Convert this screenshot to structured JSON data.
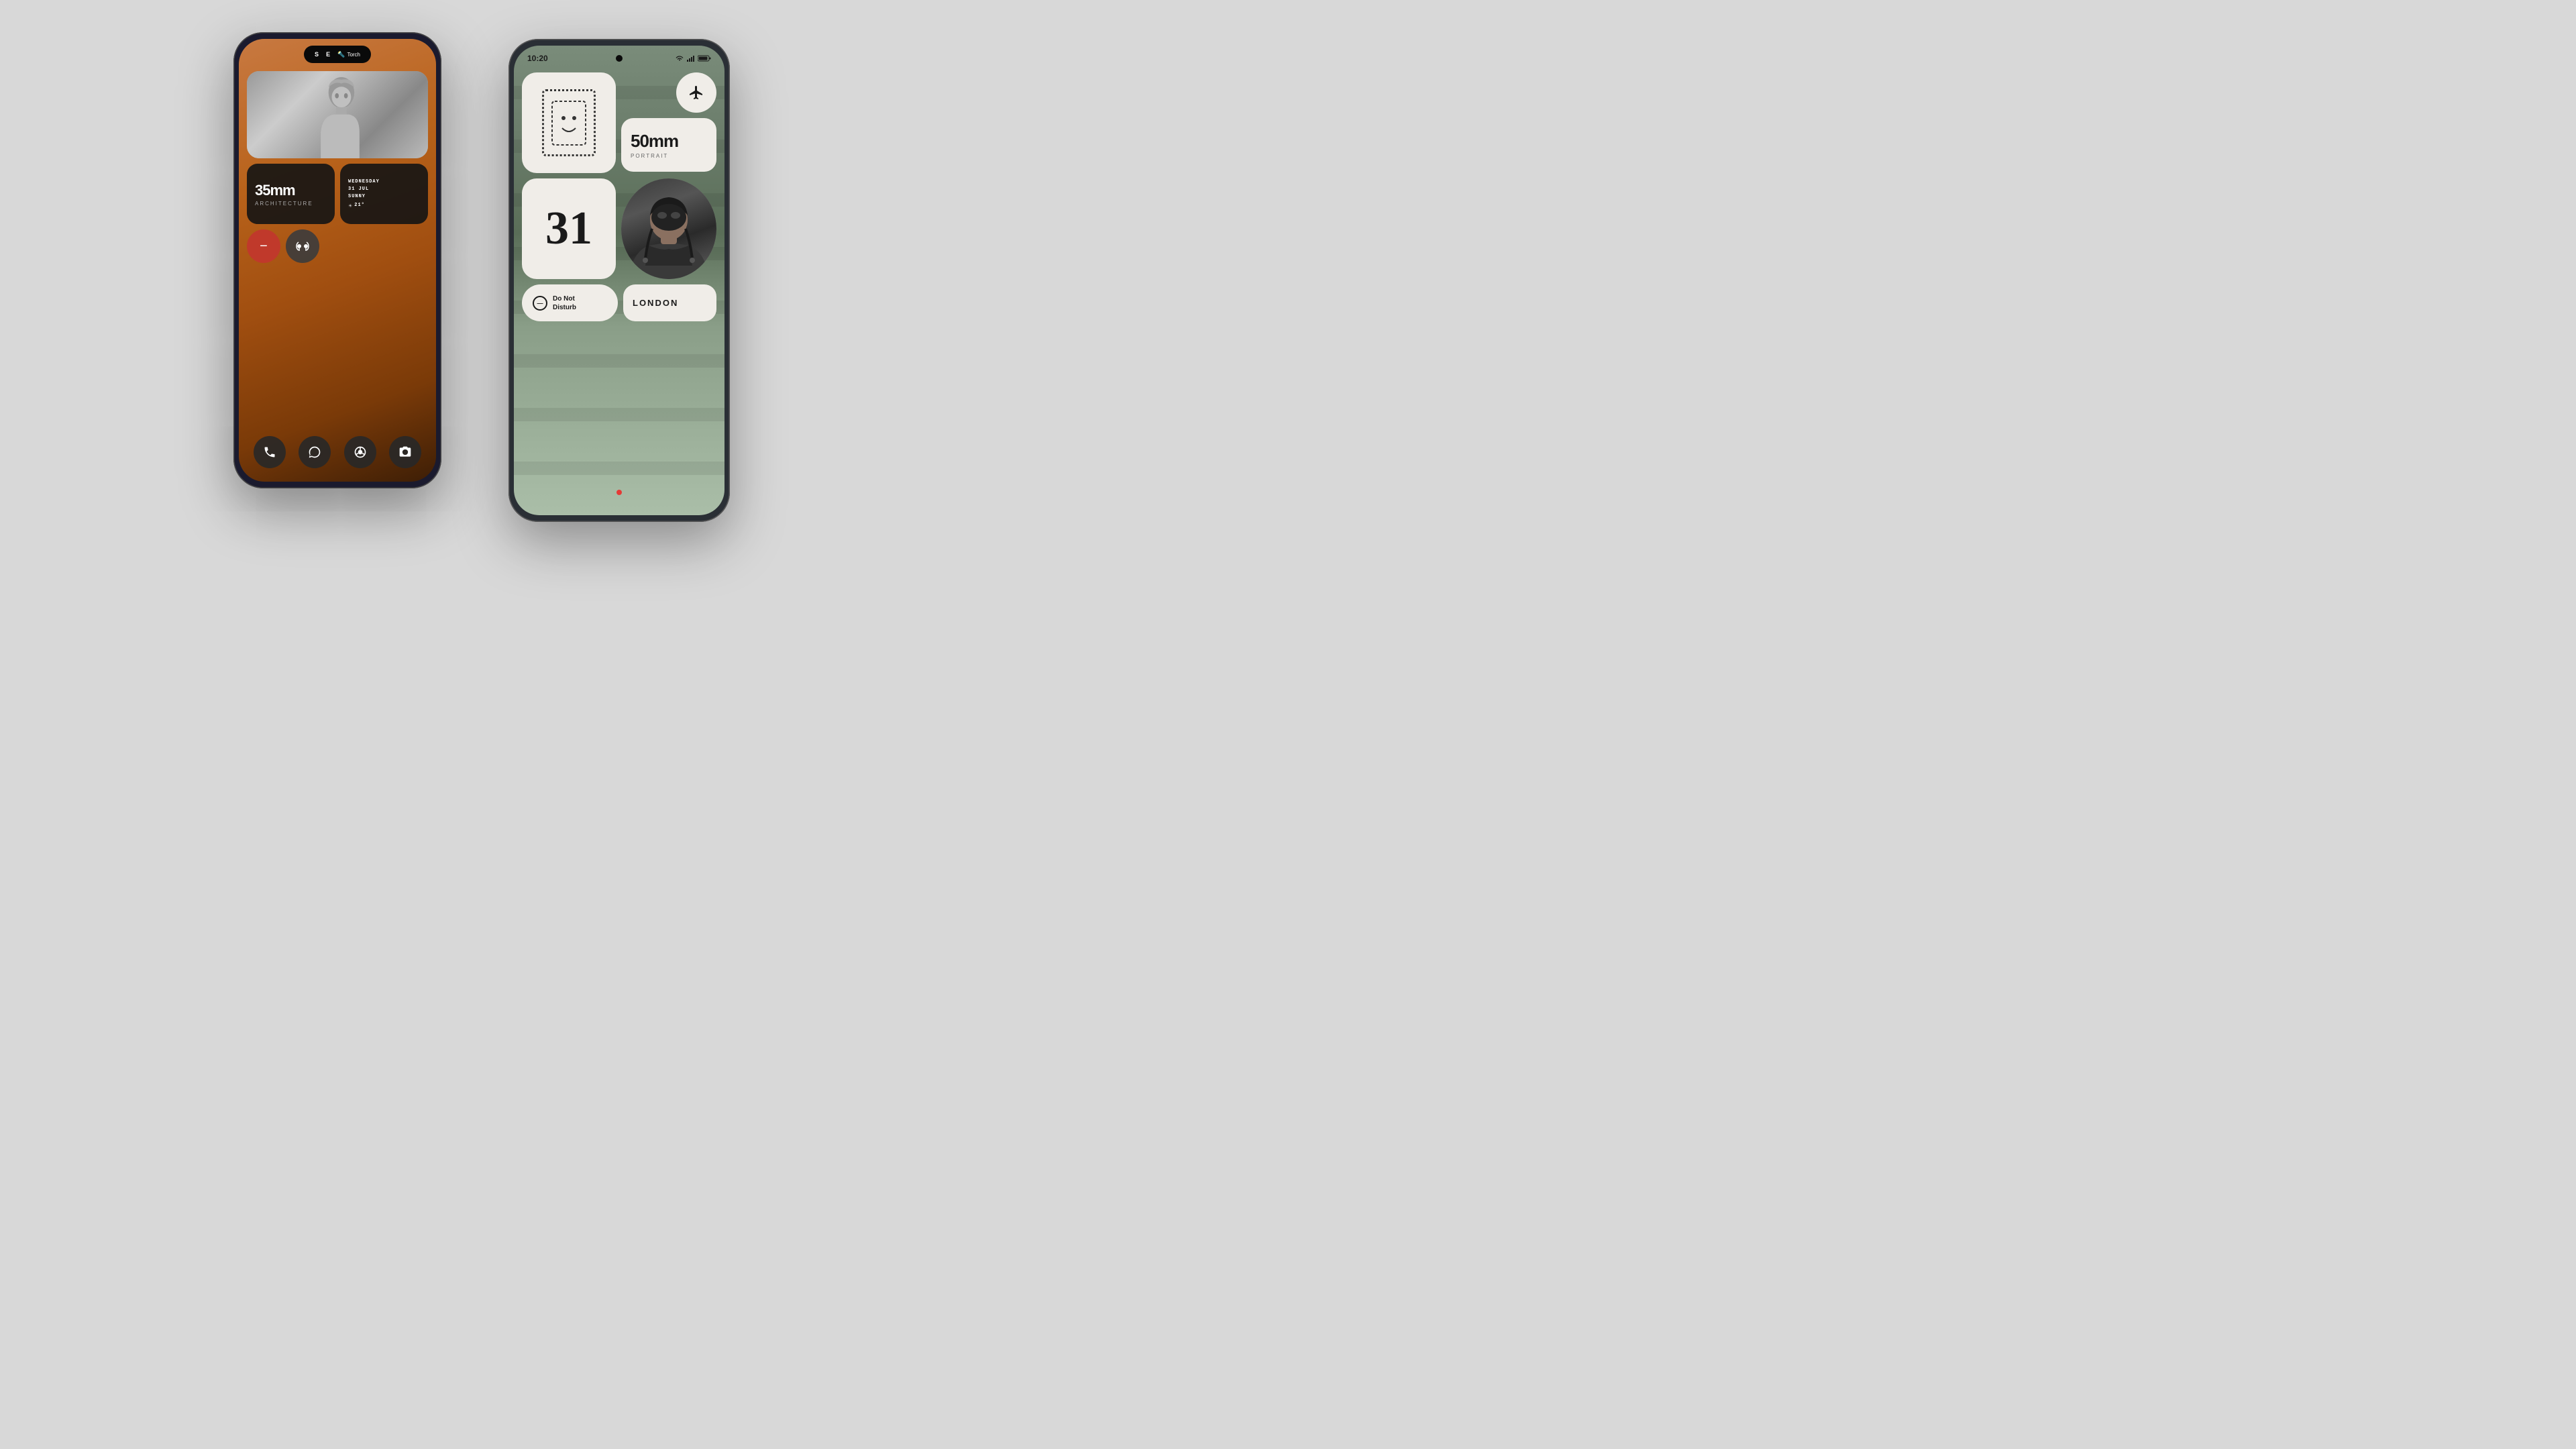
{
  "background_color": "#d8d8d8",
  "phone1": {
    "dynamic_island": {
      "left_letter": "S",
      "right_letter": "E",
      "torch_icon": "🔦",
      "torch_label": "Torch"
    },
    "photo_widget": {
      "description": "grayscale person portrait"
    },
    "widget_35mm": {
      "title": "35mm",
      "subtitle": "ARCHITECTURE"
    },
    "widget_date": {
      "day": "WEDNESDAY",
      "date": "31 JUL",
      "weather": "SUNNY",
      "temp": "21°"
    },
    "btn_minus": "−",
    "btn_airpods": "⌽",
    "dock": {
      "phone_icon": "📞",
      "message_icon": "💬",
      "chrome_icon": "⊙",
      "camera_icon": "📷"
    }
  },
  "phone2": {
    "status_bar": {
      "time": "10:20",
      "wifi": "▼",
      "signal": "▲",
      "battery": "█"
    },
    "widget_photo_frame": {
      "description": "dotted rectangle face icon"
    },
    "widget_airplane": {
      "icon": "✈"
    },
    "widget_50mm": {
      "title": "50mm",
      "subtitle": "PORTRAIT"
    },
    "widget_date31": {
      "number": "31"
    },
    "widget_avatar": {
      "description": "person with braids wearing headgear"
    },
    "widget_dnd": {
      "label_line1": "Do Not",
      "label_line2": "Disturb"
    },
    "widget_london": {
      "label": "LONDON"
    }
  }
}
